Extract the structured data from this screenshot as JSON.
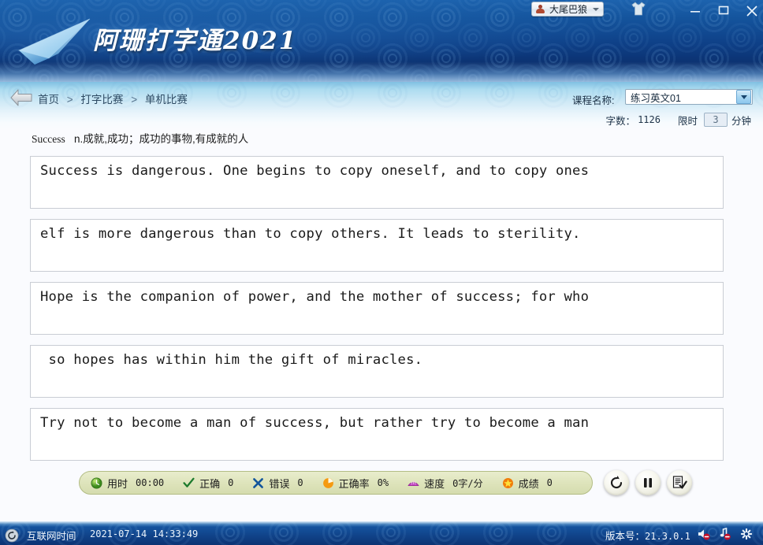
{
  "window": {
    "user_name": "大尾巴狼",
    "user_icon": "avatar-icon",
    "theme_icon": "shirt-icon",
    "minimize_icon": "minimize-icon",
    "maximize_icon": "maximize-icon",
    "close_icon": "close-icon"
  },
  "banner": {
    "brand_title": "阿珊打字通2021",
    "logo_icon": "paper-plane-logo",
    "bg_color": "#0e3f86"
  },
  "breadcrumb": {
    "back_icon": "back-arrow-icon",
    "items": [
      "首页",
      "打字比赛",
      "单机比赛"
    ],
    "separator": ">"
  },
  "course": {
    "label": "课程名称:",
    "selected": "练习英文01",
    "dropdown_icon": "chevron-down-icon"
  },
  "meta": {
    "word_count_label": "字数：",
    "word_count_value": "1126",
    "time_limit_label": "限时",
    "time_limit_value": "3",
    "time_limit_unit": "分钟"
  },
  "word_hint": {
    "word": "Success",
    "definition": "n.成就,成功；成功的事物,有成就的人"
  },
  "text_lines": [
    "Success is dangerous. One begins to copy oneself, and to copy ones",
    "elf is more dangerous than to copy others. It leads to sterility.",
    "Hope is the companion of power, and the mother of success; for who",
    " so hopes has within him the gift of miracles.",
    "Try not to become a man of success, but rather try to become a man"
  ],
  "status": {
    "time": {
      "icon": "clock-icon",
      "label": "用时",
      "value": "00:00"
    },
    "correct": {
      "icon": "check-icon",
      "label": "正确",
      "value": "0"
    },
    "wrong": {
      "icon": "cross-icon",
      "label": "错误",
      "value": "0"
    },
    "accuracy": {
      "icon": "pie-chart-icon",
      "label": "正确率",
      "value": "0%"
    },
    "speed": {
      "icon": "fan-icon",
      "label": "速度",
      "value": "0字/分"
    },
    "score": {
      "icon": "star-icon",
      "label": "成绩",
      "value": "0"
    }
  },
  "controls": {
    "restart_icon": "restart-icon",
    "pause_icon": "pause-icon",
    "submit_icon": "submit-document-icon"
  },
  "footer": {
    "refresh_icon": "refresh-icon",
    "net_time_label": "互联网时间",
    "net_time_value": "2021-07-14 14:33:49",
    "version_label": "版本号：",
    "version_value": "21.3.0.1",
    "sound_icon": "sound-muted-icon",
    "music_icon": "music-muted-icon",
    "settings_icon": "gear-icon"
  }
}
